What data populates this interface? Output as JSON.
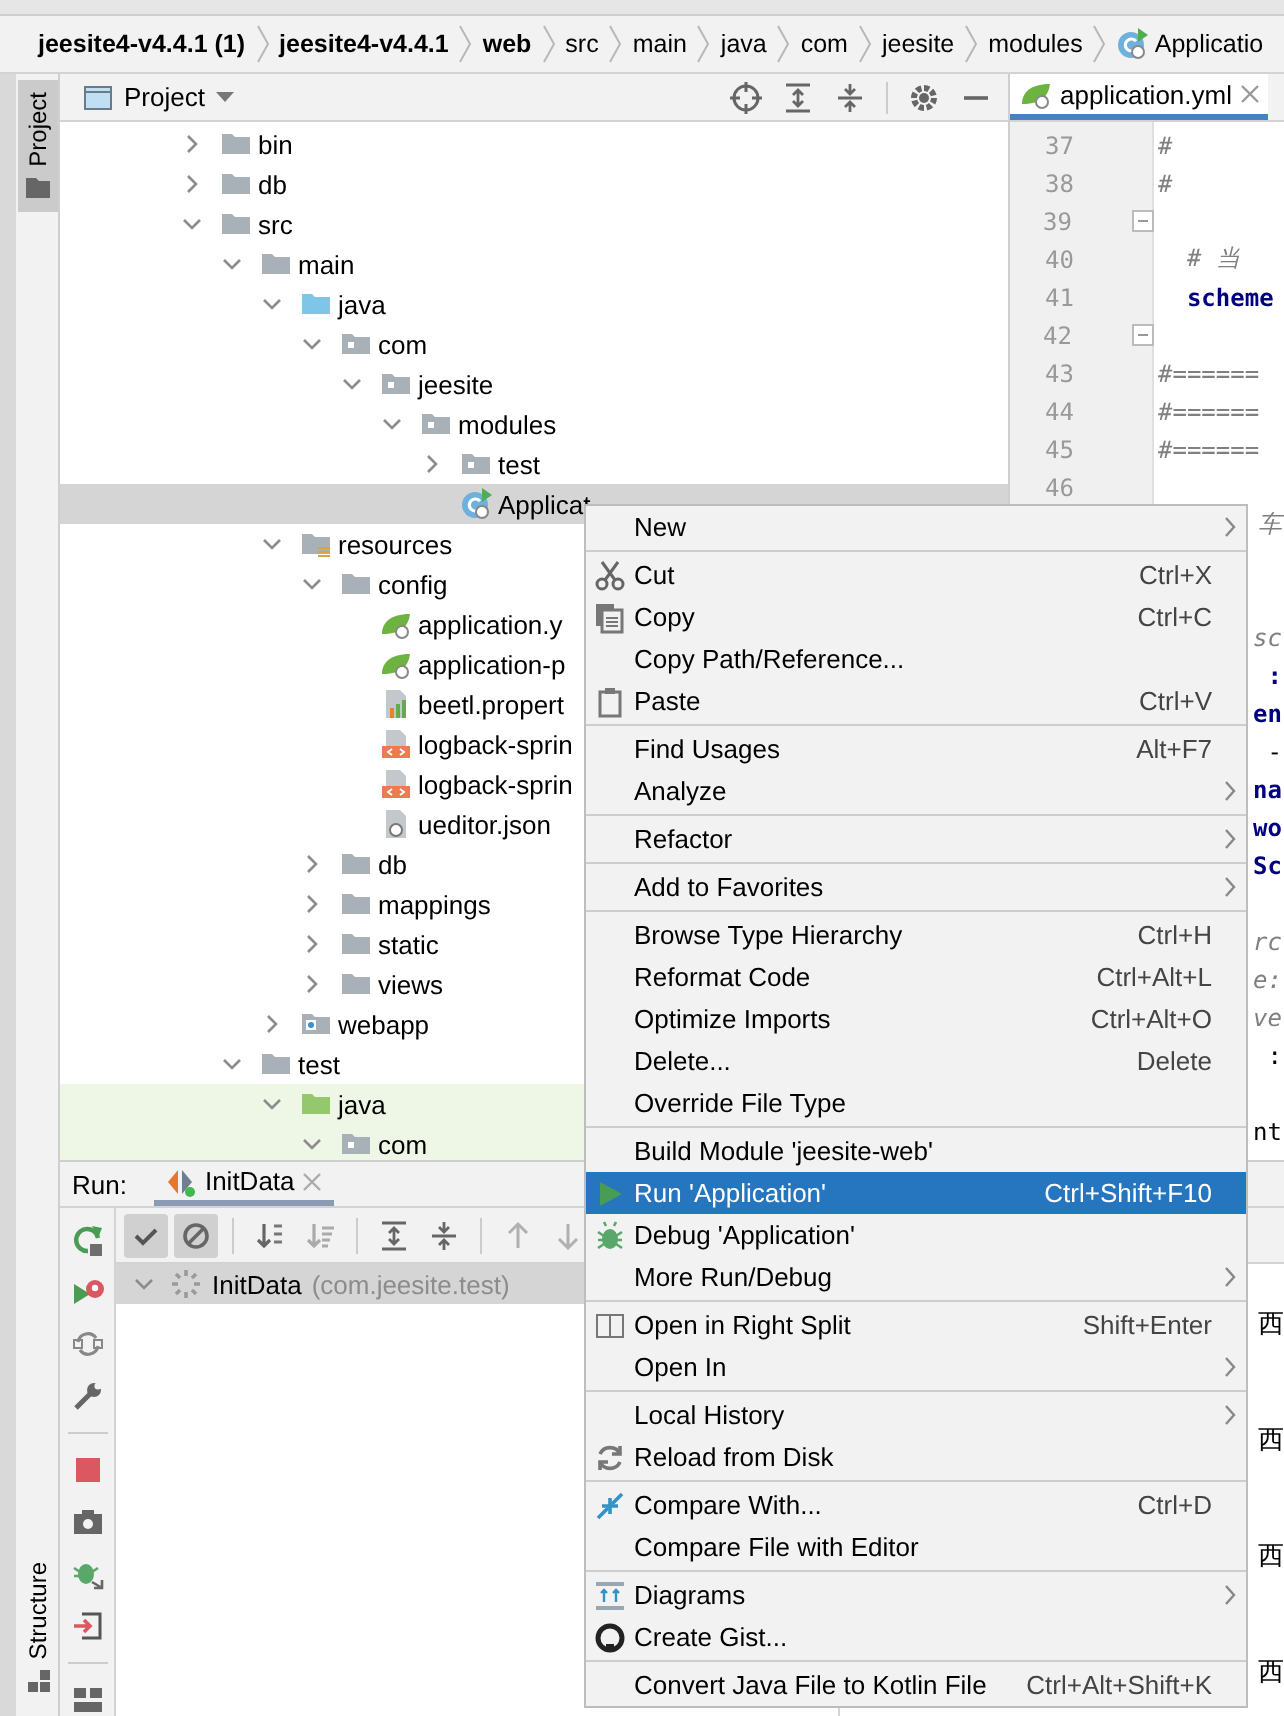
{
  "breadcrumb": [
    {
      "label": "jeesite4-v4.4.1 (1)",
      "kind": "module"
    },
    {
      "label": "jeesite4-v4.4.1",
      "kind": "module"
    },
    {
      "label": "web",
      "kind": "module"
    },
    {
      "label": "src",
      "kind": "dir"
    },
    {
      "label": "main",
      "kind": "dir"
    },
    {
      "label": "java",
      "kind": "dir"
    },
    {
      "label": "com",
      "kind": "dir"
    },
    {
      "label": "jeesite",
      "kind": "dir"
    },
    {
      "label": "modules",
      "kind": "dir"
    },
    {
      "label": "Applicatio",
      "kind": "class"
    }
  ],
  "tool_strip": {
    "top_tabs": [
      {
        "label": "Project",
        "selected": true
      }
    ],
    "bottom_tabs": [
      {
        "label": "Structure",
        "selected": false
      }
    ]
  },
  "project_panel": {
    "title": "Project",
    "tree": [
      {
        "label": "bin",
        "kind": "folder",
        "expanded": false,
        "selected": false
      },
      {
        "label": "db",
        "kind": "folder",
        "expanded": false,
        "selected": false
      },
      {
        "label": "src",
        "kind": "folder",
        "expanded": true,
        "selected": false,
        "children": [
          {
            "label": "main",
            "kind": "folder",
            "expanded": true,
            "selected": false,
            "children": [
              {
                "label": "java",
                "kind": "source",
                "expanded": true,
                "selected": false,
                "children": [
                  {
                    "label": "com",
                    "kind": "package",
                    "expanded": true,
                    "selected": false,
                    "children": [
                      {
                        "label": "jeesite",
                        "kind": "package",
                        "expanded": true,
                        "selected": false,
                        "children": [
                          {
                            "label": "modules",
                            "kind": "package",
                            "expanded": true,
                            "selected": false,
                            "children": [
                              {
                                "label": "test",
                                "kind": "package",
                                "expanded": false,
                                "selected": false
                              },
                              {
                                "label": "Applicat",
                                "kind": "class",
                                "selected": true
                              }
                            ]
                          }
                        ]
                      }
                    ]
                  }
                ]
              },
              {
                "label": "resources",
                "kind": "resources",
                "expanded": true,
                "selected": false,
                "children": [
                  {
                    "label": "config",
                    "kind": "folder",
                    "expanded": true,
                    "selected": false,
                    "children": [
                      {
                        "label": "application.y",
                        "kind": "spring",
                        "selected": false
                      },
                      {
                        "label": "application-p",
                        "kind": "spring",
                        "selected": false
                      },
                      {
                        "label": "beetl.propert",
                        "kind": "properties",
                        "selected": false
                      },
                      {
                        "label": "logback-sprin",
                        "kind": "xml",
                        "selected": false
                      },
                      {
                        "label": "logback-sprin",
                        "kind": "xml",
                        "selected": false
                      },
                      {
                        "label": "ueditor.json",
                        "kind": "json",
                        "selected": false
                      }
                    ]
                  },
                  {
                    "label": "db",
                    "kind": "folder",
                    "expanded": false,
                    "selected": false
                  },
                  {
                    "label": "mappings",
                    "kind": "folder",
                    "expanded": false,
                    "selected": false
                  },
                  {
                    "label": "static",
                    "kind": "folder",
                    "expanded": false,
                    "selected": false
                  },
                  {
                    "label": "views",
                    "kind": "folder",
                    "expanded": false,
                    "selected": false
                  }
                ]
              },
              {
                "label": "webapp",
                "kind": "web",
                "expanded": false,
                "selected": false
              }
            ]
          },
          {
            "label": "test",
            "kind": "folder",
            "expanded": true,
            "selected": false,
            "children": [
              {
                "label": "java",
                "kind": "test-source",
                "expanded": true,
                "selected": false,
                "children": [
                  {
                    "label": "com",
                    "kind": "package",
                    "expanded": true,
                    "selected": false
                  }
                ]
              }
            ]
          }
        ]
      }
    ]
  },
  "editor": {
    "tabs": [
      {
        "label": "application.yml",
        "selected": true
      }
    ],
    "lines": [
      {
        "number": "37",
        "text": "#",
        "kind": "comment",
        "fold": false
      },
      {
        "number": "38",
        "text": "#",
        "kind": "comment",
        "fold": false
      },
      {
        "number": "39",
        "fold": true
      },
      {
        "number": "40",
        "text": "  # 当",
        "kind": "comment",
        "fold": false
      },
      {
        "number": "41",
        "text": "  scheme",
        "kind": "key",
        "fold": false
      },
      {
        "number": "42",
        "fold": true
      },
      {
        "number": "43",
        "text": "#======",
        "kind": "comment",
        "fold": false
      },
      {
        "number": "44",
        "text": "#======",
        "kind": "comment",
        "fold": false
      },
      {
        "number": "45",
        "text": "#======",
        "kind": "comment",
        "fold": false
      },
      {
        "number": "46",
        "fold": false
      },
      {
        "text": "车",
        "kind": "comment"
      },
      {
        "kind": "covered"
      },
      {
        "kind": "covered"
      },
      {
        "text": "sc",
        "kind": "comment"
      },
      {
        "text": ":",
        "kind": "key"
      },
      {
        "text": "en",
        "kind": "key"
      },
      {
        "text": "-",
        "kind": "plain"
      },
      {
        "text": "na",
        "kind": "key"
      },
      {
        "text": "wo",
        "kind": "key"
      },
      {
        "text": "Sc",
        "kind": "key"
      },
      {
        "kind": "covered"
      },
      {
        "text": "rc",
        "kind": "comment"
      },
      {
        "text": "e:",
        "kind": "comment"
      },
      {
        "text": "ve",
        "kind": "comment"
      },
      {
        "text": ":",
        "kind": "plain"
      },
      {
        "kind": "covered"
      },
      {
        "text": "nt",
        "kind": "plain"
      }
    ]
  },
  "run_panel": {
    "title": "Run:",
    "tabs": [
      {
        "label": "InitData",
        "selected": true
      }
    ],
    "toolbar": [
      {
        "kind": "check",
        "on": true
      },
      {
        "kind": "ban",
        "on": true
      },
      {
        "kind": "sort-alpha",
        "on": false
      },
      {
        "kind": "sort-duration",
        "on": false
      },
      {
        "kind": "expand-all",
        "on": false
      },
      {
        "kind": "collapse-all",
        "on": false
      },
      {
        "kind": "arrow-up",
        "on": false
      },
      {
        "kind": "arrow-down",
        "on": false
      }
    ],
    "tests": [
      {
        "name": "InitData",
        "package": "(com.jeesite.test)",
        "expanded": true,
        "selected": true
      }
    ],
    "console": [
      {
        "text": "西"
      },
      {
        "text": "西"
      },
      {
        "text": "西"
      },
      {
        "text": "西"
      }
    ]
  },
  "context_menu": {
    "groups": [
      [
        {
          "label": "New",
          "submenu": true,
          "selected": false
        }
      ],
      [
        {
          "label": "Cut",
          "kind": "scissors",
          "shortcut": "Ctrl+X",
          "submenu": false,
          "selected": false
        },
        {
          "label": "Copy",
          "kind": "copy",
          "shortcut": "Ctrl+C",
          "submenu": false,
          "selected": false
        },
        {
          "label": "Copy Path/Reference...",
          "submenu": false,
          "selected": false
        },
        {
          "label": "Paste",
          "kind": "paste",
          "shortcut": "Ctrl+V",
          "submenu": false,
          "selected": false
        }
      ],
      [
        {
          "label": "Find Usages",
          "shortcut": "Alt+F7",
          "submenu": false,
          "selected": false
        },
        {
          "label": "Analyze",
          "submenu": true,
          "selected": false
        }
      ],
      [
        {
          "label": "Refactor",
          "submenu": true,
          "selected": false
        }
      ],
      [
        {
          "label": "Add to Favorites",
          "submenu": true,
          "selected": false
        }
      ],
      [
        {
          "label": "Browse Type Hierarchy",
          "shortcut": "Ctrl+H",
          "submenu": false,
          "selected": false
        },
        {
          "label": "Reformat Code",
          "shortcut": "Ctrl+Alt+L",
          "submenu": false,
          "selected": false
        },
        {
          "label": "Optimize Imports",
          "shortcut": "Ctrl+Alt+O",
          "submenu": false,
          "selected": false
        },
        {
          "label": "Delete...",
          "shortcut": "Delete",
          "submenu": false,
          "selected": false
        },
        {
          "label": "Override File Type",
          "submenu": false,
          "selected": false
        }
      ],
      [
        {
          "label": "Build Module 'jeesite-web'",
          "submenu": false,
          "selected": false
        },
        {
          "label": "Run 'Application'",
          "kind": "play",
          "shortcut": "Ctrl+Shift+F10",
          "submenu": false,
          "selected": true
        },
        {
          "label": "Debug 'Application'",
          "kind": "bug",
          "submenu": false,
          "selected": false
        },
        {
          "label": "More Run/Debug",
          "submenu": true,
          "selected": false
        }
      ],
      [
        {
          "label": "Open in Right Split",
          "kind": "split",
          "shortcut": "Shift+Enter",
          "submenu": false,
          "selected": false
        },
        {
          "label": "Open In",
          "submenu": true,
          "selected": false
        }
      ],
      [
        {
          "label": "Local History",
          "submenu": true,
          "selected": false
        },
        {
          "label": "Reload from Disk",
          "kind": "reload",
          "submenu": false,
          "selected": false
        }
      ],
      [
        {
          "label": "Compare With...",
          "kind": "compare",
          "shortcut": "Ctrl+D",
          "submenu": false,
          "selected": false
        },
        {
          "label": "Compare File with Editor",
          "submenu": false,
          "selected": false
        }
      ],
      [
        {
          "label": "Diagrams",
          "kind": "diagram",
          "submenu": true,
          "selected": false
        },
        {
          "label": "Create Gist...",
          "kind": "gist",
          "submenu": false,
          "selected": false
        }
      ],
      [
        {
          "label": "Convert Java File to Kotlin File",
          "shortcut": "Ctrl+Alt+Shift+K",
          "submenu": false,
          "selected": false
        }
      ]
    ]
  }
}
